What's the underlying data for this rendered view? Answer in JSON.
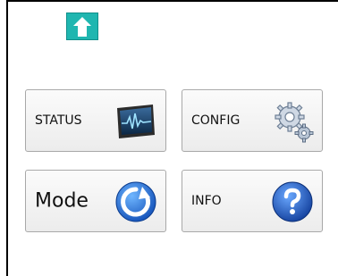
{
  "nav": {
    "up_icon": "arrow-up-icon"
  },
  "tiles": {
    "status": {
      "label": "STATUS",
      "icon": "monitor-waveform-icon"
    },
    "config": {
      "label": "CONFIG",
      "icon": "gears-icon"
    },
    "mode": {
      "label": "Mode",
      "icon": "refresh-icon"
    },
    "info": {
      "label": "INFO",
      "icon": "question-icon"
    }
  },
  "colors": {
    "up_button": "#1fb6b0",
    "refresh_blue": "#1f6fd6",
    "help_blue": "#1d5fc0"
  }
}
